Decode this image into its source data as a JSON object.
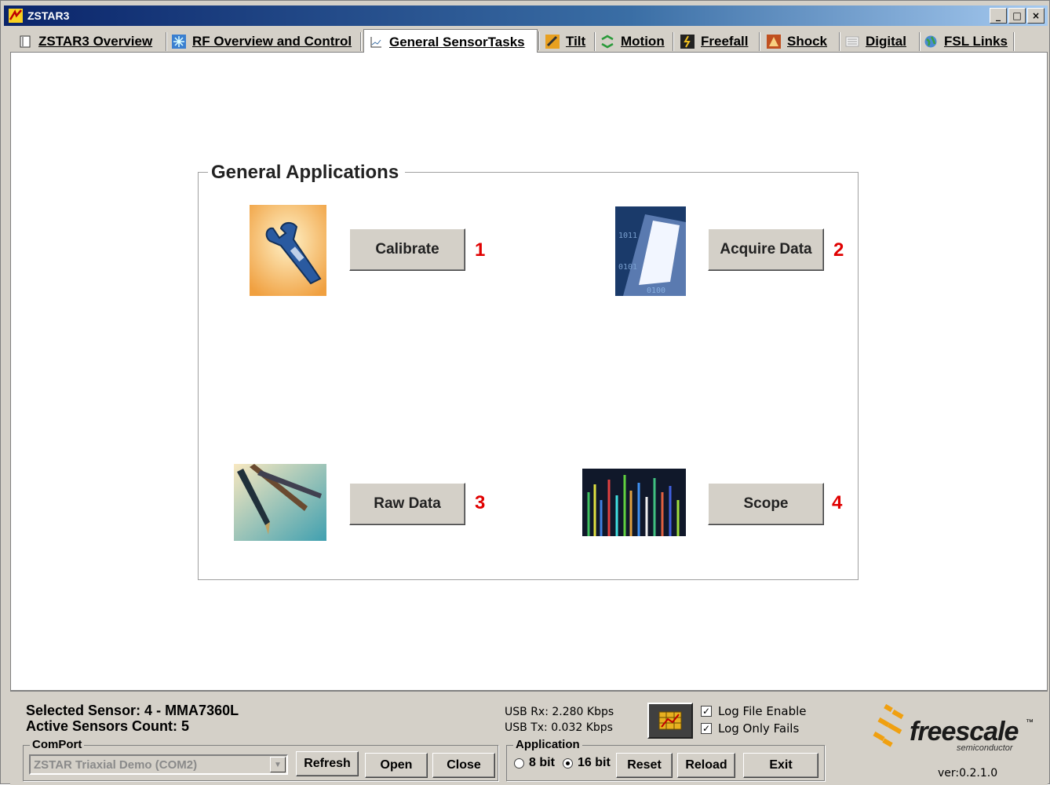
{
  "window": {
    "title": "ZSTAR3",
    "minimize": "_",
    "maximize": "□",
    "close": "×"
  },
  "tabs": [
    {
      "label": "ZSTAR3 Overview",
      "icon": "document-icon"
    },
    {
      "label": "RF Overview and Control",
      "icon": "rf-icon"
    },
    {
      "label": "General SensorTasks",
      "icon": "chart-icon",
      "active": true
    },
    {
      "label": "Tilt",
      "icon": "tilt-icon"
    },
    {
      "label": "Motion",
      "icon": "motion-icon"
    },
    {
      "label": "Freefall",
      "icon": "freefall-icon"
    },
    {
      "label": "Shock",
      "icon": "shock-icon"
    },
    {
      "label": "Digital",
      "icon": "digital-icon"
    },
    {
      "label": "FSL Links",
      "icon": "globe-icon"
    }
  ],
  "group": {
    "title": "General Applications",
    "items": [
      {
        "button": "Calibrate",
        "number": "1",
        "image": "wrench-image"
      },
      {
        "button": "Acquire Data",
        "number": "2",
        "image": "binary-data-image"
      },
      {
        "button": "Raw Data",
        "number": "3",
        "image": "pens-image"
      },
      {
        "button": "Scope",
        "number": "4",
        "image": "spectrum-image"
      }
    ]
  },
  "status": {
    "selected_sensor": "Selected Sensor: 4 - MMA7360L",
    "active_count": "Active Sensors Count: 5",
    "comport_legend": "ComPort",
    "comport_value": "ZSTAR Triaxial Demo (COM2)",
    "refresh": "Refresh",
    "open": "Open",
    "close": "Close",
    "usb_rx": "USB Rx:  2.280 Kbps",
    "usb_tx": "USB Tx:  0.032 Kbps",
    "log_file_enable": "Log File Enable",
    "log_only_fails": "Log Only Fails",
    "check_mark": "✓",
    "application_legend": "Application",
    "bit8": "8 bit",
    "bit16": "16 bit",
    "reset": "Reset",
    "reload": "Reload",
    "exit": "Exit",
    "logo_text": "freescale",
    "logo_tm": "™",
    "logo_sub": "semiconductor",
    "version": "ver:0.2.1.0"
  },
  "colors": {
    "accent_number": "#e00000",
    "titlebar": "#0a246a",
    "face": "#d4d0c8"
  }
}
